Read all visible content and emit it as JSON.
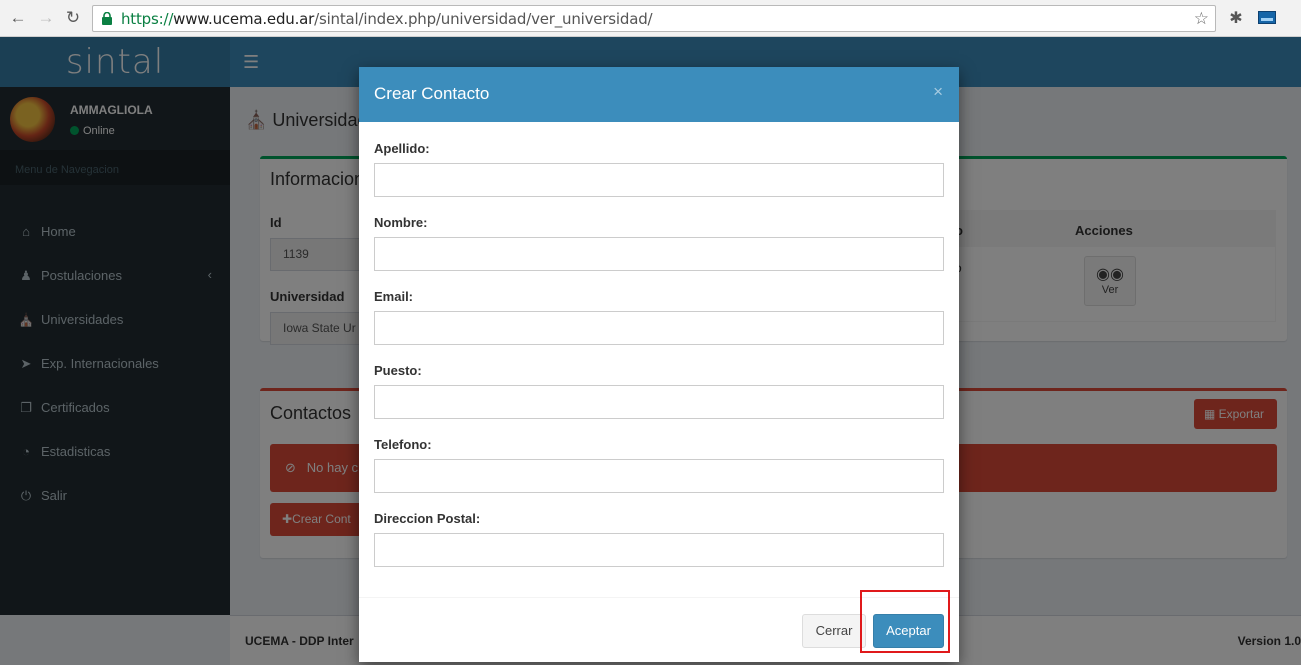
{
  "browser": {
    "url_scheme": "https://",
    "url_host": "www.ucema.edu.ar",
    "url_path": "/sintal/index.php/universidad/ver_universidad/"
  },
  "app": {
    "logo_text": "sintal"
  },
  "sidebar": {
    "user_name": "AMMAGLIOLA",
    "user_status": "Online",
    "menu_header": "Menu de Navegacion",
    "items": [
      {
        "label": "Home",
        "icon": "home-icon"
      },
      {
        "label": "Postulaciones",
        "icon": "users-icon"
      },
      {
        "label": "Universidades",
        "icon": "university-icon"
      },
      {
        "label": "Exp. Internacionales",
        "icon": "paper-plane-icon"
      },
      {
        "label": "Certificados",
        "icon": "files-icon"
      },
      {
        "label": "Estadisticas",
        "icon": "pie-chart-icon"
      },
      {
        "label": "Salir",
        "icon": "power-icon"
      }
    ]
  },
  "content": {
    "page_title": "Universidad",
    "info_box_title": "Informacion",
    "id_label": "Id",
    "id_value": "1139",
    "universidad_label": "Universidad",
    "universidad_value": "Iowa State Ur",
    "table_col_partial": "o",
    "table_cell_partial": "o",
    "acciones_label": "Acciones",
    "ver_label": "Ver",
    "contactos_title": "Contactos",
    "exportar_label": "Exportar",
    "alert_text": "No hay c",
    "crear_contacto_label": "Crear Cont"
  },
  "footer": {
    "left": "UCEMA - DDP Inter",
    "right": "Version 1.0"
  },
  "modal": {
    "title": "Crear Contacto",
    "close_symbol": "×",
    "fields": [
      {
        "label": "Apellido:",
        "value": ""
      },
      {
        "label": "Nombre:",
        "value": ""
      },
      {
        "label": "Email:",
        "value": ""
      },
      {
        "label": "Puesto:",
        "value": ""
      },
      {
        "label": "Telefono:",
        "value": ""
      },
      {
        "label": "Direccion Postal:",
        "value": ""
      }
    ],
    "cerrar_label": "Cerrar",
    "aceptar_label": "Aceptar"
  },
  "colors": {
    "primary": "#3c8dbc",
    "sidebar": "#222d32",
    "danger": "#dd4b39",
    "success": "#00a65a",
    "highlight": "#e0191b"
  }
}
